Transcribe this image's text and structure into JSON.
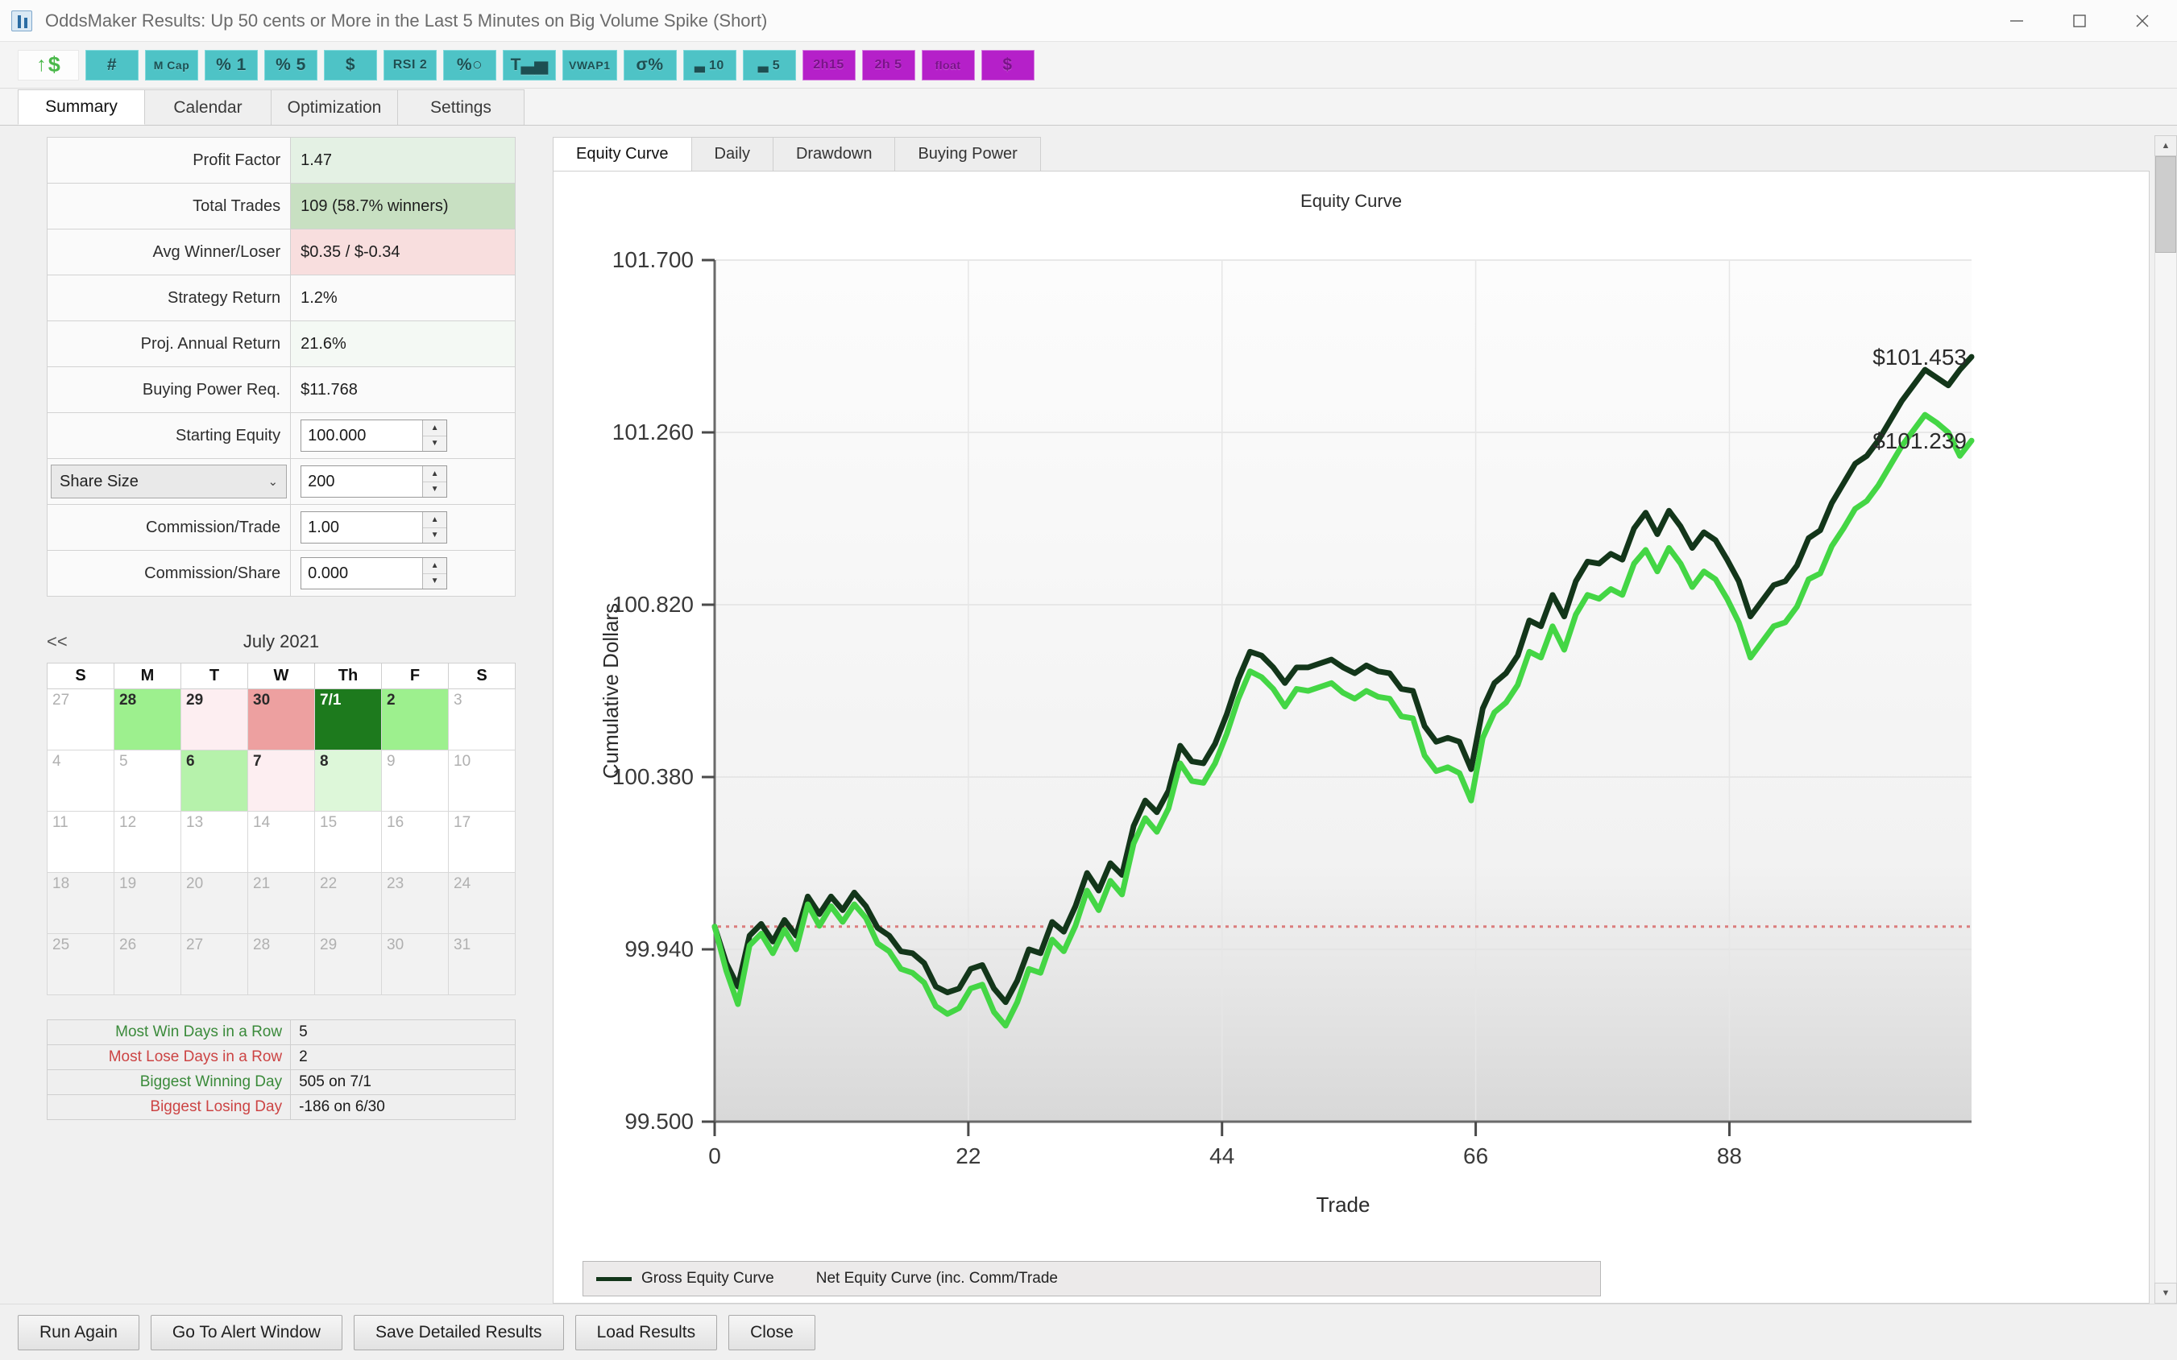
{
  "window": {
    "title": "OddsMaker Results: Up 50 cents or More in the Last 5 Minutes on Big Volume Spike (Short)",
    "icon": "chart-bars-icon",
    "minimize": "–",
    "maximize": "□",
    "close": "✕"
  },
  "toolbar": {
    "first": {
      "arrow": "↑",
      "dollar": "$"
    },
    "buttons": [
      {
        "label": "#",
        "color": "#4ec3c6",
        "size": "lg"
      },
      {
        "label": "M Cap",
        "color": "#4ec3c6",
        "size": "xs"
      },
      {
        "label": "% 1",
        "color": "#4ec3c6",
        "size": "lg"
      },
      {
        "label": "% 5",
        "color": "#4ec3c6",
        "size": "lg"
      },
      {
        "label": "$",
        "color": "#4ec3c6",
        "size": "lg"
      },
      {
        "label": "RSI 2",
        "color": "#4ec3c6",
        "size": "sm"
      },
      {
        "label": "%○",
        "color": "#4ec3c6",
        "size": "lg"
      },
      {
        "label": "T▃▅",
        "color": "#4ec3c6",
        "size": "lg"
      },
      {
        "label": "VWAP1",
        "color": "#4ec3c6",
        "size": "xs"
      },
      {
        "label": "σ%",
        "color": "#4ec3c6",
        "size": "lg"
      },
      {
        "label": "▃ 10",
        "color": "#4ec3c6",
        "size": "sm"
      },
      {
        "label": "▃ 5",
        "color": "#4ec3c6",
        "size": "sm"
      },
      {
        "label": "2h15",
        "color": "#b520c9",
        "size": "sm"
      },
      {
        "label": "2h 5",
        "color": "#b520c9",
        "size": "sm"
      },
      {
        "label": "float",
        "color": "#b520c9",
        "size": "xs"
      },
      {
        "label": "$",
        "color": "#b520c9",
        "size": "lg"
      }
    ]
  },
  "main_tabs": [
    {
      "label": "Summary",
      "active": true
    },
    {
      "label": "Calendar",
      "active": false
    },
    {
      "label": "Optimization",
      "active": false
    },
    {
      "label": "Settings",
      "active": false
    }
  ],
  "stats": {
    "rows": [
      {
        "label": "Profit Factor",
        "value": "1.47",
        "tone": "g1"
      },
      {
        "label": "Total Trades",
        "value": "109 (58.7% winners)",
        "tone": "g2"
      },
      {
        "label": "Avg Winner/Loser",
        "value": "$0.35 / $-0.34",
        "tone": "r1"
      },
      {
        "label": "Strategy Return",
        "value": "1.2%",
        "tone": "plain"
      },
      {
        "label": "Proj. Annual Return",
        "value": "21.6%",
        "tone": "g0"
      },
      {
        "label": "Buying Power Req.",
        "value": "$11.768",
        "tone": "plain"
      }
    ],
    "starting_equity": {
      "label": "Starting Equity",
      "value": "100.000"
    },
    "share_size": {
      "label": "Share Size",
      "value": "200",
      "chevron": "⌄"
    },
    "commission_trade": {
      "label": "Commission/Trade",
      "value": "1.00"
    },
    "commission_share": {
      "label": "Commission/Share",
      "value": "0.000"
    },
    "spinner_up": "▲",
    "spinner_down": "▼"
  },
  "calendar": {
    "prev": "<<",
    "month": "July 2021",
    "daynames": [
      "S",
      "M",
      "T",
      "W",
      "Th",
      "F",
      "S"
    ],
    "weeks": [
      [
        {
          "d": "27",
          "cls": "dim"
        },
        {
          "d": "28",
          "cls": "cur",
          "bg": "#9df08e"
        },
        {
          "d": "29",
          "cls": "cur",
          "bg": "#fdeef1"
        },
        {
          "d": "30",
          "cls": "cur",
          "bg": "#eda0a0"
        },
        {
          "d": "7/1",
          "cls": "cur",
          "bg": "#1d7a1d",
          "fg": "#ffffff"
        },
        {
          "d": "2",
          "cls": "cur",
          "bg": "#9df08e"
        },
        {
          "d": "3",
          "cls": "dim"
        }
      ],
      [
        {
          "d": "4",
          "cls": "dim"
        },
        {
          "d": "5",
          "cls": "dim"
        },
        {
          "d": "6",
          "cls": "cur",
          "bg": "#b6f2ab"
        },
        {
          "d": "7",
          "cls": "cur",
          "bg": "#fdeef1"
        },
        {
          "d": "8",
          "cls": "cur",
          "bg": "#ddf7d9"
        },
        {
          "d": "9",
          "cls": "dim"
        },
        {
          "d": "10",
          "cls": "dim"
        }
      ],
      [
        {
          "d": "11",
          "cls": "dim"
        },
        {
          "d": "12",
          "cls": "dim"
        },
        {
          "d": "13",
          "cls": "dim"
        },
        {
          "d": "14",
          "cls": "dim"
        },
        {
          "d": "15",
          "cls": "dim"
        },
        {
          "d": "16",
          "cls": "dim"
        },
        {
          "d": "17",
          "cls": "dim"
        }
      ],
      [
        {
          "d": "18",
          "cls": "dim gray"
        },
        {
          "d": "19",
          "cls": "dim gray"
        },
        {
          "d": "20",
          "cls": "dim gray"
        },
        {
          "d": "21",
          "cls": "dim gray"
        },
        {
          "d": "22",
          "cls": "dim gray"
        },
        {
          "d": "23",
          "cls": "dim gray"
        },
        {
          "d": "24",
          "cls": "dim gray"
        }
      ],
      [
        {
          "d": "25",
          "cls": "dim gray"
        },
        {
          "d": "26",
          "cls": "dim gray"
        },
        {
          "d": "27",
          "cls": "dim gray"
        },
        {
          "d": "28",
          "cls": "dim gray"
        },
        {
          "d": "29",
          "cls": "dim gray"
        },
        {
          "d": "30",
          "cls": "dim gray"
        },
        {
          "d": "31",
          "cls": "dim gray"
        }
      ]
    ]
  },
  "streaks": [
    {
      "label": "Most Win Days in a Row",
      "value": "5",
      "tone": "win"
    },
    {
      "label": "Most Lose Days in a Row",
      "value": "2",
      "tone": "lose"
    },
    {
      "label": "Biggest Winning Day",
      "value": "505 on 7/1",
      "tone": "win"
    },
    {
      "label": "Biggest Losing Day",
      "value": "-186 on 6/30",
      "tone": "lose"
    }
  ],
  "chart_tabs": [
    {
      "label": "Equity Curve",
      "active": true
    },
    {
      "label": "Daily",
      "active": false
    },
    {
      "label": "Drawdown",
      "active": false
    },
    {
      "label": "Buying Power",
      "active": false
    }
  ],
  "legend": [
    {
      "label": "Gross Equity Curve",
      "color": "#13361a"
    },
    {
      "label": "Net Equity Curve (inc. Comm/Trade",
      "color": "#44d645"
    }
  ],
  "footer_buttons": [
    "Run Again",
    "Go To Alert Window",
    "Save Detailed Results",
    "Load Results",
    "Close"
  ],
  "scroll": {
    "up": "▲",
    "down": "▼"
  },
  "chart_data": {
    "type": "line",
    "title": "Equity Curve",
    "xlabel": "Trade",
    "ylabel": "Cumulative Dollars",
    "xlim": [
      0,
      109
    ],
    "ylim": [
      99.5,
      101.7
    ],
    "xticks": [
      0,
      22,
      44,
      66,
      88
    ],
    "yticks": [
      99.5,
      99.94,
      100.38,
      100.82,
      101.26,
      101.7
    ],
    "grid": true,
    "reference_line": {
      "value": 99.998,
      "color": "#d96a6a",
      "style": "dotted"
    },
    "legend_position": "bottom-left",
    "annotations": [
      {
        "text": "$101.453",
        "series": "Gross Equity Curve",
        "x": 109,
        "y": 101.453
      },
      {
        "text": "$101.239",
        "series": "Net Equity Curve (inc. Comm/Trade",
        "x": 109,
        "y": 101.239
      }
    ],
    "series": [
      {
        "name": "Gross Equity Curve",
        "color": "#13361a",
        "values": [
          99.998,
          99.905,
          99.845,
          99.975,
          100.005,
          99.96,
          100.015,
          99.975,
          100.075,
          100.03,
          100.075,
          100.04,
          100.085,
          100.05,
          99.995,
          99.975,
          99.935,
          99.93,
          99.905,
          99.845,
          99.83,
          99.84,
          99.89,
          99.9,
          99.84,
          99.805,
          99.86,
          99.94,
          99.93,
          100.01,
          99.985,
          100.05,
          100.135,
          100.09,
          100.16,
          100.13,
          100.255,
          100.32,
          100.29,
          100.345,
          100.46,
          100.42,
          100.415,
          100.465,
          100.54,
          100.63,
          100.7,
          100.69,
          100.66,
          100.62,
          100.66,
          100.66,
          100.67,
          100.68,
          100.66,
          100.645,
          100.665,
          100.65,
          100.645,
          100.605,
          100.6,
          100.51,
          100.47,
          100.48,
          100.47,
          100.4,
          100.555,
          100.62,
          100.645,
          100.69,
          100.78,
          100.765,
          100.845,
          100.79,
          100.88,
          100.93,
          100.925,
          100.95,
          100.935,
          101.015,
          101.055,
          101.0,
          101.06,
          101.02,
          100.965,
          101.005,
          100.985,
          100.935,
          100.88,
          100.79,
          100.83,
          100.87,
          100.88,
          100.92,
          100.99,
          101.01,
          101.08,
          101.13,
          101.18,
          101.2,
          101.24,
          101.29,
          101.34,
          101.38,
          101.42,
          101.4,
          101.38,
          101.42,
          101.453
        ]
      },
      {
        "name": "Net Equity Curve (inc. Comm/Trade",
        "color": "#44d645",
        "values": [
          99.998,
          99.885,
          99.8,
          99.95,
          99.98,
          99.93,
          99.99,
          99.94,
          100.055,
          100.0,
          100.05,
          100.01,
          100.055,
          100.02,
          99.955,
          99.935,
          99.89,
          99.88,
          99.855,
          99.795,
          99.775,
          99.79,
          99.84,
          99.85,
          99.78,
          99.745,
          99.805,
          99.89,
          99.88,
          99.965,
          99.935,
          100.0,
          100.09,
          100.04,
          100.115,
          100.08,
          100.21,
          100.275,
          100.24,
          100.3,
          100.415,
          100.37,
          100.365,
          100.415,
          100.49,
          100.58,
          100.65,
          100.635,
          100.605,
          100.56,
          100.605,
          100.6,
          100.61,
          100.62,
          100.595,
          100.58,
          100.6,
          100.585,
          100.58,
          100.535,
          100.53,
          100.435,
          100.395,
          100.405,
          100.39,
          100.32,
          100.48,
          100.545,
          100.57,
          100.615,
          100.7,
          100.685,
          100.765,
          100.705,
          100.795,
          100.845,
          100.835,
          100.86,
          100.845,
          100.925,
          100.96,
          100.905,
          100.965,
          100.925,
          100.865,
          100.905,
          100.885,
          100.835,
          100.775,
          100.685,
          100.725,
          100.765,
          100.775,
          100.815,
          100.885,
          100.9,
          100.97,
          101.015,
          101.065,
          101.085,
          101.125,
          101.175,
          101.225,
          101.265,
          101.305,
          101.285,
          101.26,
          101.2,
          101.239
        ]
      }
    ]
  }
}
